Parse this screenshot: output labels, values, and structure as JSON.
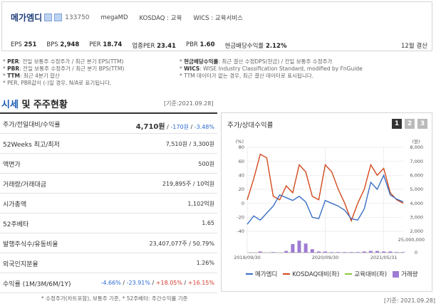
{
  "header": {
    "company": "메가엠디",
    "code": "133750",
    "english": "megaMD",
    "market": "KOSDAQ : 교육",
    "wics": "WICS : 교육서비스"
  },
  "indicators": [
    {
      "label": "EPS",
      "value": "251"
    },
    {
      "label": "BPS",
      "value": "2,948"
    },
    {
      "label": "PER",
      "value": "18.74"
    },
    {
      "label": "업종PER",
      "value": "23.41"
    },
    {
      "label": "PBR",
      "value": "1.60"
    },
    {
      "label": "현금배당수익률",
      "value": "2.12%"
    }
  ],
  "fiscal": "12월 결산",
  "notes": {
    "left": [
      {
        "key": "PER",
        "text": ": 전일 보통주 수정주가 / 최근 분기 EPS(TTM)"
      },
      {
        "key": "PBR",
        "text": ": 전일 보통주 수정주가 / 최근 분기 BPS(TTM)"
      },
      {
        "key": "TTM",
        "text": ": 최근 4분기 합산"
      },
      {
        "key": "",
        "text": "PER, PBR값이 (-)일 경우, N/A로 표기됩니다."
      }
    ],
    "right": [
      {
        "key": "현금배당수익률",
        "text": ": 최근 결산 수정DPS(현금) / 전일 보통주 수정주가"
      },
      {
        "key": "WICS",
        "text": ": WISE Industry Classification Standard, modified by FnGuide"
      },
      {
        "key": "",
        "text": "TTM 데이터가 없는 경우, 최근 결산 데이터로 표시됩니다."
      }
    ]
  },
  "section": {
    "title_highlight": "시세",
    "title_rest": " 및 주주현황",
    "base_date": "[기준:2021.09.28]"
  },
  "table": [
    {
      "label": "주가/전일대비/수익률",
      "price": "4,710원",
      "sep1": " / ",
      "change": "-170원",
      "sep2": " / ",
      "pct": "-3.48%"
    },
    {
      "label": "52Weeks 최고/최저",
      "value": "7,510원 / 3,300원"
    },
    {
      "label": "액면가",
      "value": "500원"
    },
    {
      "label": "거래량/거래대금",
      "value": "219,895주 / 10억원"
    },
    {
      "label": "시가총액",
      "value": "1,102억원"
    },
    {
      "label": "52주베타",
      "value": "1.65"
    },
    {
      "label": "발행주식수/유동비율",
      "value": "23,407,077주 / 50.79%"
    },
    {
      "label": "외국인지분율",
      "value": "1.26%"
    },
    {
      "label": "수익률 (1M/3M/6M/1Y)",
      "r1": "-4.66%",
      "r2": "-23.91%",
      "r3": "+18.05%",
      "r4": "+16.15%",
      "sep": " / "
    }
  ],
  "table_note": "* 수정주가(차트포함), 보통주 기준, * 52주베타: 주간수익률 기준",
  "base_date_bottom": "[기준: 2021.09.28]",
  "chart": {
    "title": "주가/상대수익률",
    "tabs": [
      "1",
      "2",
      "3"
    ],
    "legend": [
      {
        "name": "메가엠디",
        "color": "#3a6fc4",
        "kind": "line"
      },
      {
        "name": "KOSDAQ대비(좌)",
        "color": "#d24a1e",
        "kind": "line"
      },
      {
        "name": "교육대비(좌)",
        "color": "#8cc63f",
        "kind": "line"
      },
      {
        "name": "거래량",
        "color": "#9f7bd3",
        "kind": "bar"
      }
    ]
  },
  "chart_data": {
    "type": "line",
    "x": [
      "2019/09/30",
      "2020/09/30",
      "2021/05/31"
    ],
    "left_axis_label": "(%)",
    "left_ticks": [
      80,
      60,
      40,
      20,
      0,
      -20,
      -40
    ],
    "right_axis_label": "(원)",
    "right_ticks": [
      "8,000",
      "7,000",
      "6,000",
      "5,000",
      "4,000",
      "3,000",
      "2,000"
    ],
    "volume_tick": "25,000,000",
    "volume_zero": "0",
    "series": [
      {
        "name": "메가엠디",
        "axis": "right",
        "values": [
          2500,
          3100,
          2800,
          3300,
          3800,
          4600,
          4400,
          4200,
          4500,
          4100,
          3000,
          2900,
          4200,
          4000,
          3800,
          3500,
          2900,
          2800,
          3600,
          5500,
          5000,
          6000,
          4600,
          4300,
          4100
        ]
      },
      {
        "name": "KOSDAQ대비(좌)",
        "axis": "left",
        "values": [
          5,
          35,
          70,
          65,
          10,
          5,
          25,
          15,
          55,
          45,
          10,
          5,
          55,
          45,
          20,
          0,
          -25,
          0,
          20,
          55,
          40,
          50,
          15,
          5,
          0
        ]
      },
      {
        "name": "거래량",
        "axis": "volume",
        "values": [
          0,
          0,
          2,
          0,
          1,
          0,
          3,
          15,
          21,
          16,
          6,
          2,
          2,
          1,
          1,
          1,
          1,
          1,
          2,
          3,
          3,
          2,
          2,
          1,
          1
        ]
      }
    ]
  }
}
